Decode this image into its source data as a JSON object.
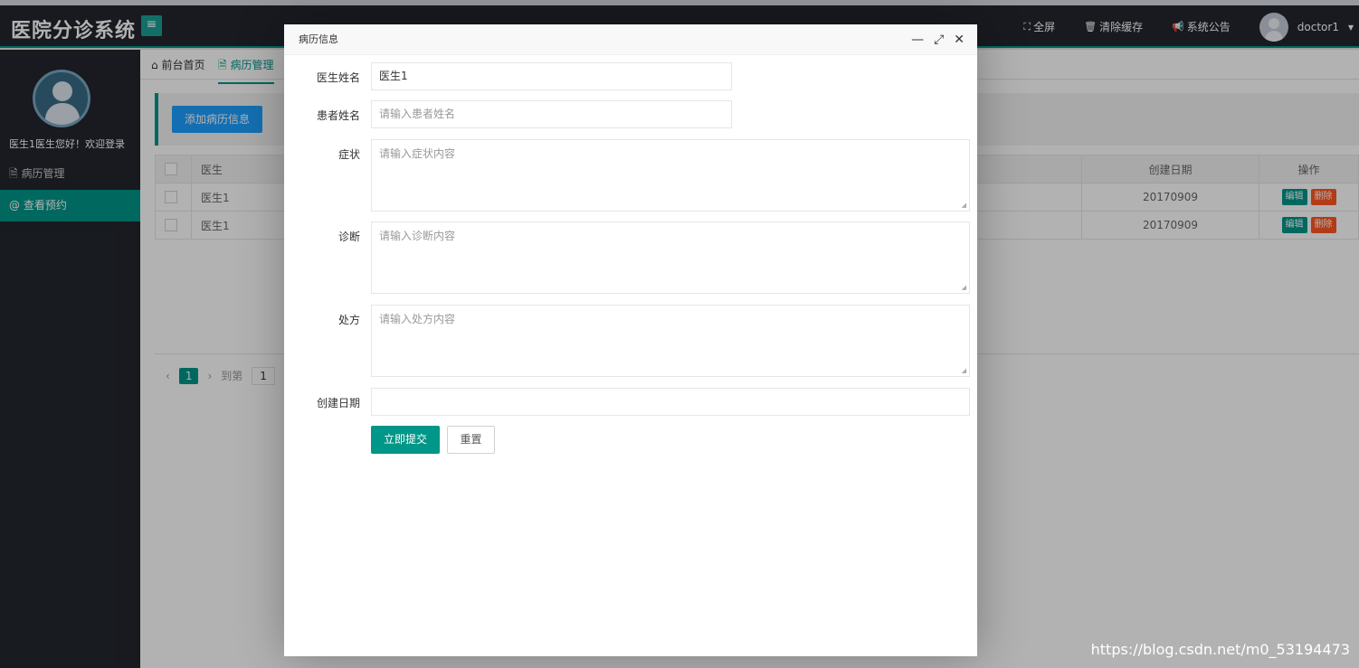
{
  "header": {
    "logo": "医院分诊系统",
    "toggle_glyph": "≡",
    "fullscreen": "全屏",
    "clear_cache": "清除缓存",
    "announcement": "系统公告",
    "username": "doctor1"
  },
  "sidebar": {
    "welcome": "医生1医生您好！欢迎登录",
    "items": [
      {
        "label": "病历管理"
      },
      {
        "label": "查看预约"
      }
    ]
  },
  "tabs": [
    {
      "label": "前台首页"
    },
    {
      "label": "病历管理"
    }
  ],
  "toolbar": {
    "add_label": "添加病历信息"
  },
  "table": {
    "headers": [
      "医生",
      "创建日期",
      "操作"
    ],
    "rows": [
      {
        "doctor": "医生1",
        "date": "20170909"
      },
      {
        "doctor": "医生1",
        "date": "20170909"
      }
    ],
    "edit_label": "编辑",
    "delete_label": "删除"
  },
  "pager": {
    "current": "1",
    "goto_label": "到第",
    "goto_value": "1"
  },
  "dialog": {
    "title": "病历信息",
    "fields": {
      "doctor_label": "医生姓名",
      "doctor_value": "医生1",
      "patient_label": "患者姓名",
      "patient_placeholder": "请输入患者姓名",
      "symptom_label": "症状",
      "symptom_placeholder": "请输入症状内容",
      "diagnosis_label": "诊断",
      "diagnosis_placeholder": "请输入诊断内容",
      "prescription_label": "处方",
      "prescription_placeholder": "请输入处方内容",
      "date_label": "创建日期",
      "date_value": ""
    },
    "submit_label": "立即提交",
    "reset_label": "重置"
  },
  "watermark": "https://blog.csdn.net/m0_53194473"
}
